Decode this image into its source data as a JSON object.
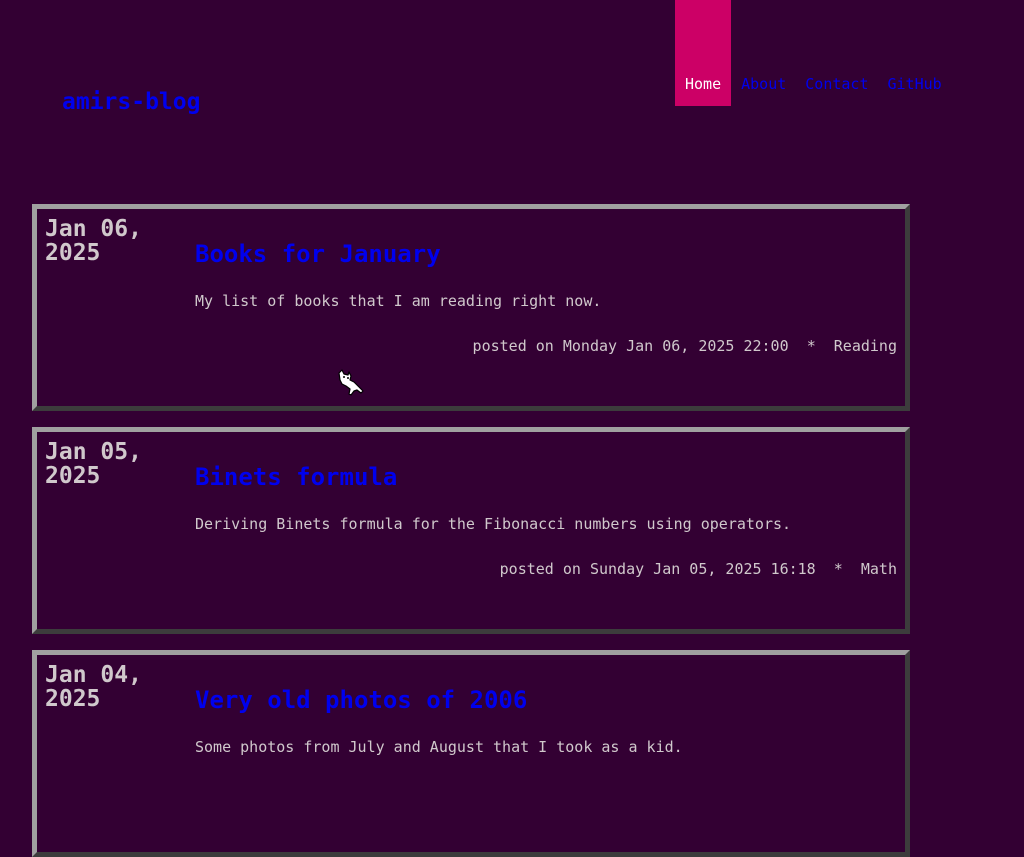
{
  "site": {
    "title": "amirs-blog"
  },
  "nav": {
    "items": [
      {
        "label": "Home",
        "active": true
      },
      {
        "label": "About",
        "active": false
      },
      {
        "label": "Contact",
        "active": false
      },
      {
        "label": "GitHub",
        "active": false
      }
    ]
  },
  "posts": [
    {
      "date_line1": "Jan 06,",
      "date_line2": "2025",
      "title": "Books for January",
      "summary": "My list of books that I am reading right now.",
      "meta_prefix": "posted on Monday Jan 06, 2025 22:00",
      "separator": "*",
      "category": "Reading"
    },
    {
      "date_line1": "Jan 05,",
      "date_line2": "2025",
      "title": "Binets formula",
      "summary": "Deriving Binets formula for the Fibonacci numbers using operators.",
      "meta_prefix": "posted on Sunday Jan 05, 2025 16:18",
      "separator": "*",
      "category": "Math"
    },
    {
      "date_line1": "Jan 04,",
      "date_line2": "2025",
      "title": "Very old photos of 2006",
      "summary": "Some photos from July and August that I took as a kid.",
      "meta_prefix": "",
      "separator": "",
      "category": ""
    }
  ],
  "colors": {
    "background": "#330033",
    "link": "#0000ee",
    "nav_active_bg": "#cc0066",
    "text": "#d0c8cc",
    "border_light": "#a0a0a0",
    "border_dark": "#3c3c3c"
  },
  "cursor": {
    "icon": "oneko-cat-cursor-icon"
  }
}
